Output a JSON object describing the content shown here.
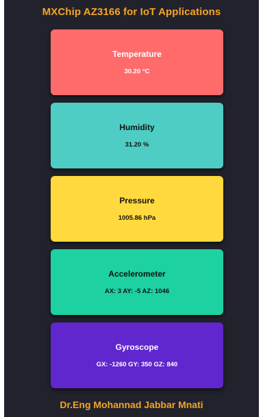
{
  "header": {
    "title": "MXChip AZ3166 for IoT Applications"
  },
  "sensors": [
    {
      "label": "Temperature",
      "value": "30.20 °C",
      "bg": "#ff6b6b",
      "fg": "#ffffff"
    },
    {
      "label": "Humidity",
      "value": "31.20 %",
      "bg": "#4ecdc4",
      "fg": "#111111"
    },
    {
      "label": "Pressure",
      "value": "1005.86 hPa",
      "bg": "#ffd93d",
      "fg": "#111111"
    },
    {
      "label": "Accelerometer",
      "value": "AX: 3 AY: -5 AZ: 1046",
      "bg": "#1dd1a1",
      "fg": "#111111"
    },
    {
      "label": "Gyroscope",
      "value": "GX: -1260 GY: 350 GZ: 840",
      "bg": "#5f27cd",
      "fg": "#ffffff"
    }
  ],
  "footer": {
    "author": "Dr.Eng Mohannad Jabbar Mnati"
  },
  "colors": {
    "background": "#22222c",
    "accent": "#f5a524"
  }
}
